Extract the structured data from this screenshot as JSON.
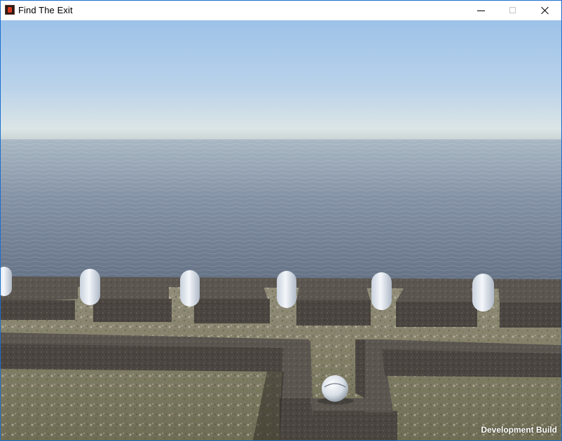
{
  "window": {
    "title": "Find The Exit",
    "icon": "unity-player-icon",
    "controls": {
      "minimize": "minimize-icon",
      "maximize": "maximize-icon",
      "close": "close-icon"
    }
  },
  "game": {
    "watermark": "Development Build",
    "colors": {
      "sky_top": "#9ec3e9",
      "horizon": "#dde4e3",
      "water": "#6b788c",
      "wall": "#4a4540",
      "ground": "#8d8a76",
      "capsule": "#e5ebf3"
    }
  }
}
